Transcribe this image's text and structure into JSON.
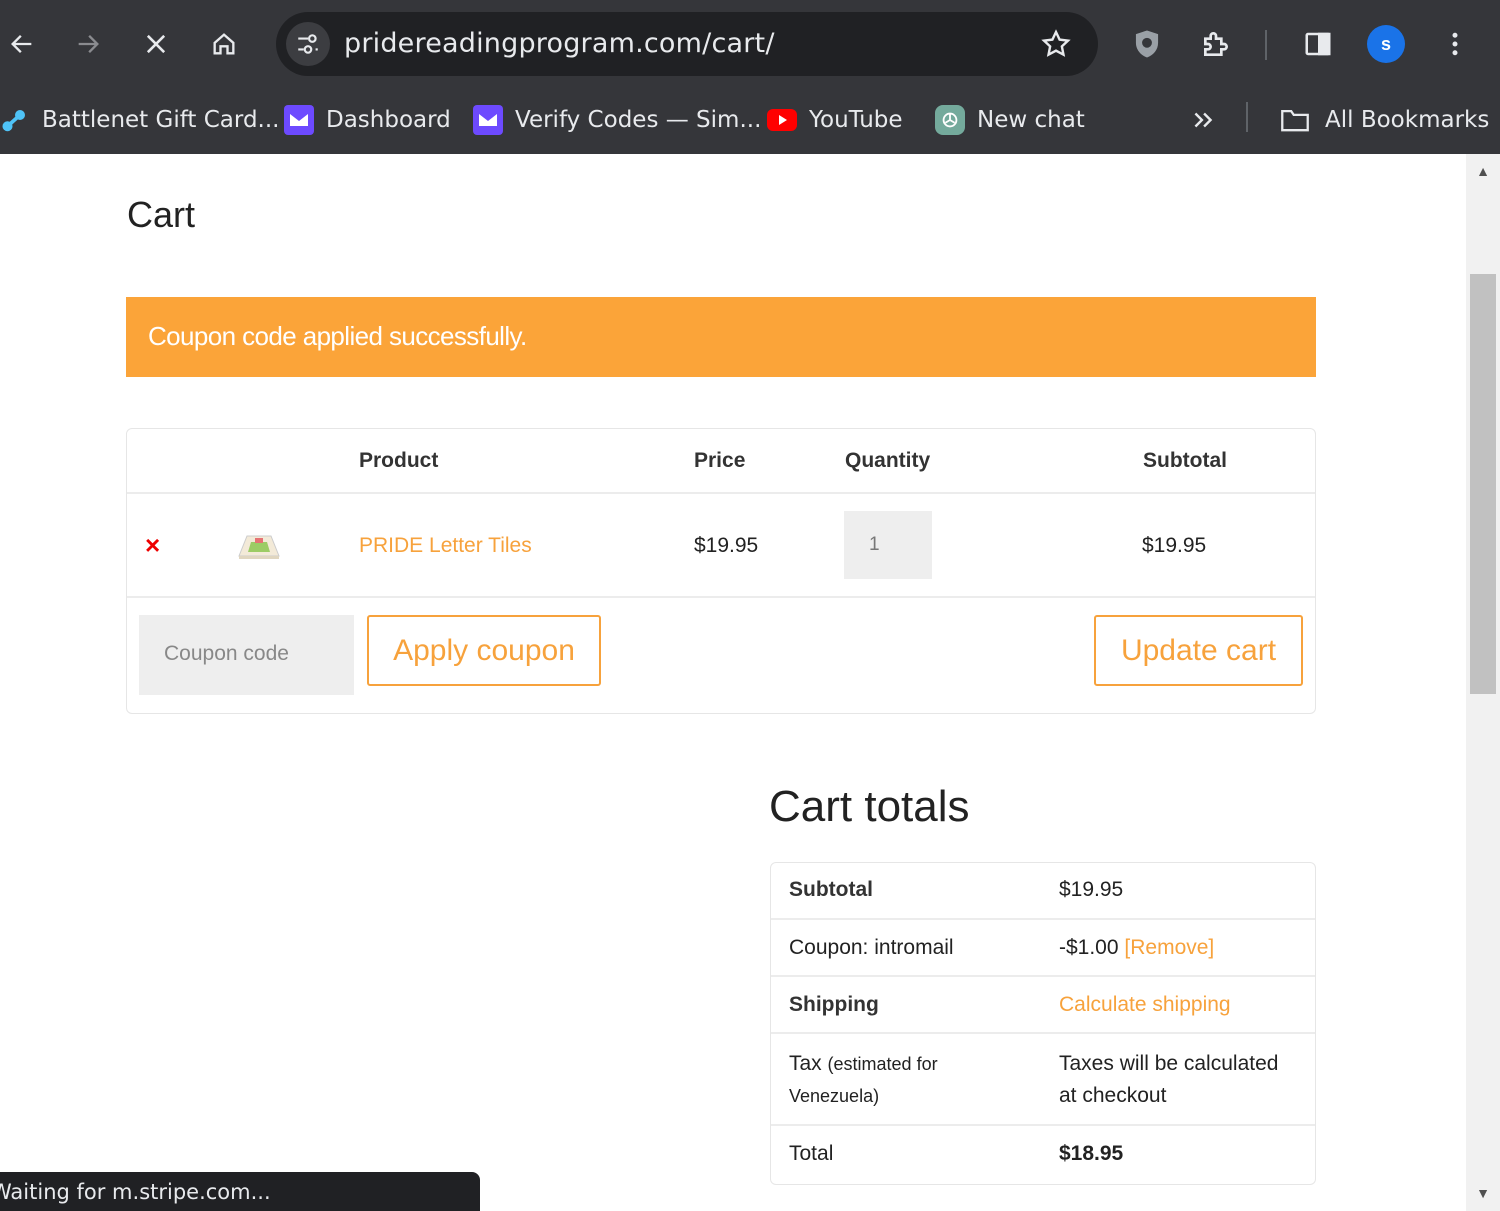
{
  "browser": {
    "url": "pridereadingprogram.com/cart/",
    "profile_initial": "s",
    "bookmarks": [
      {
        "label": "Battlenet Gift Card...",
        "icon": "battlenet-icon"
      },
      {
        "label": "Dashboard",
        "icon": "proton-mail-icon"
      },
      {
        "label": "Verify Codes — Sim...",
        "icon": "proton-mail-icon"
      },
      {
        "label": "YouTube",
        "icon": "youtube-icon"
      },
      {
        "label": "New chat",
        "icon": "chatgpt-icon"
      }
    ],
    "all_bookmarks_label": "All Bookmarks",
    "status_text": "Waiting for m.stripe.com..."
  },
  "page": {
    "title": "Cart",
    "notice": "Coupon code applied successfully.",
    "cart_table": {
      "headers": {
        "product": "Product",
        "price": "Price",
        "quantity": "Quantity",
        "subtotal": "Subtotal"
      },
      "items": [
        {
          "remove": "×",
          "name": "PRIDE Letter Tiles",
          "price": "$19.95",
          "quantity": "1",
          "subtotal": "$19.95"
        }
      ],
      "coupon_placeholder": "Coupon code",
      "apply_coupon_label": "Apply coupon",
      "update_cart_label": "Update cart"
    },
    "totals": {
      "title": "Cart totals",
      "subtotal_label": "Subtotal",
      "subtotal_value": "$19.95",
      "coupon_label": "Coupon: intromail",
      "coupon_value": "-$1.00",
      "coupon_remove": "[Remove]",
      "shipping_label": "Shipping",
      "shipping_value": "Calculate shipping",
      "tax_label": "Tax",
      "tax_note": "(estimated for Venezuela)",
      "tax_value": "Taxes will be calculated at checkout",
      "total_label": "Total",
      "total_value": "$18.95"
    }
  },
  "colors": {
    "accent": "#f7a23c",
    "notice_bg": "#fba439",
    "remove": "#ee0000",
    "chrome_bg": "#35363a"
  }
}
